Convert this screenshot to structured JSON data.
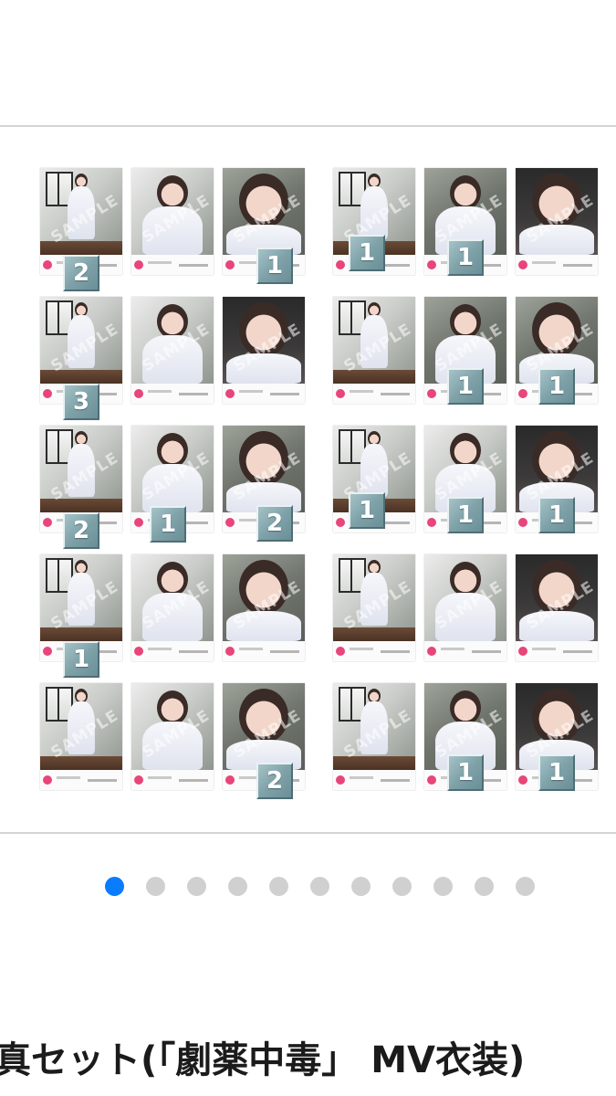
{
  "carousel": {
    "photos": [
      {
        "badge": "2",
        "style": "lighting",
        "shot": "full"
      },
      {
        "badge": "",
        "style": "lighting",
        "shot": "half"
      },
      {
        "badge": "1",
        "style": "wall",
        "shot": "close"
      },
      {
        "badge": "1",
        "style": "lighting",
        "shot": "full"
      },
      {
        "badge": "1",
        "style": "wall",
        "shot": "half"
      },
      {
        "badge": "",
        "style": "dark",
        "shot": "close"
      },
      {
        "badge": "3",
        "style": "lighting",
        "shot": "full"
      },
      {
        "badge": "",
        "style": "lighting",
        "shot": "half"
      },
      {
        "badge": "",
        "style": "dark",
        "shot": "close"
      },
      {
        "badge": "",
        "style": "lighting",
        "shot": "full"
      },
      {
        "badge": "1",
        "style": "wall",
        "shot": "half"
      },
      {
        "badge": "1",
        "style": "wall",
        "shot": "close"
      },
      {
        "badge": "2",
        "style": "lighting",
        "shot": "full"
      },
      {
        "badge": "1",
        "style": "lighting",
        "shot": "half"
      },
      {
        "badge": "2",
        "style": "wall",
        "shot": "close"
      },
      {
        "badge": "1",
        "style": "lighting",
        "shot": "full"
      },
      {
        "badge": "1",
        "style": "lighting",
        "shot": "half"
      },
      {
        "badge": "1",
        "style": "dark",
        "shot": "close"
      },
      {
        "badge": "1",
        "style": "lighting",
        "shot": "full"
      },
      {
        "badge": "",
        "style": "lighting",
        "shot": "half"
      },
      {
        "badge": "",
        "style": "wall",
        "shot": "close"
      },
      {
        "badge": "",
        "style": "lighting",
        "shot": "full"
      },
      {
        "badge": "",
        "style": "lighting",
        "shot": "half"
      },
      {
        "badge": "",
        "style": "dark",
        "shot": "close"
      },
      {
        "badge": "",
        "style": "lighting",
        "shot": "full"
      },
      {
        "badge": "",
        "style": "lighting",
        "shot": "half"
      },
      {
        "badge": "2",
        "style": "wall",
        "shot": "close"
      },
      {
        "badge": "",
        "style": "lighting",
        "shot": "full"
      },
      {
        "badge": "1",
        "style": "wall",
        "shot": "half"
      },
      {
        "badge": "1",
        "style": "dark",
        "shot": "close"
      }
    ],
    "watermark_text": "SAMPLE",
    "page_count": 11,
    "active_page": 0,
    "active_dot_color": "#0a7cff",
    "inactive_dot_color": "#d0d0d0"
  },
  "product": {
    "title": "真セット(「劇薬中毒」 MV衣装)"
  }
}
